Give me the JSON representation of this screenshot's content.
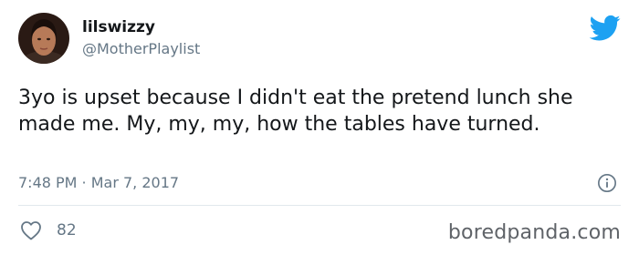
{
  "user": {
    "display_name": "lilswizzy",
    "handle": "@MotherPlaylist"
  },
  "icons": {
    "bird": "twitter-bird-icon",
    "info": "info-icon",
    "heart": "heart-icon"
  },
  "colors": {
    "twitter_blue": "#1da1f2",
    "secondary_text": "#657786",
    "primary_text": "#14171a",
    "divider": "#e1e8ed"
  },
  "tweet": {
    "text": "3yo is upset because I didn't eat the pretend lunch she made me. My, my, my, how the tables have turned.",
    "timestamp": "7:48 PM · Mar 7, 2017",
    "likes": "82"
  },
  "watermark": "boredpanda.com"
}
